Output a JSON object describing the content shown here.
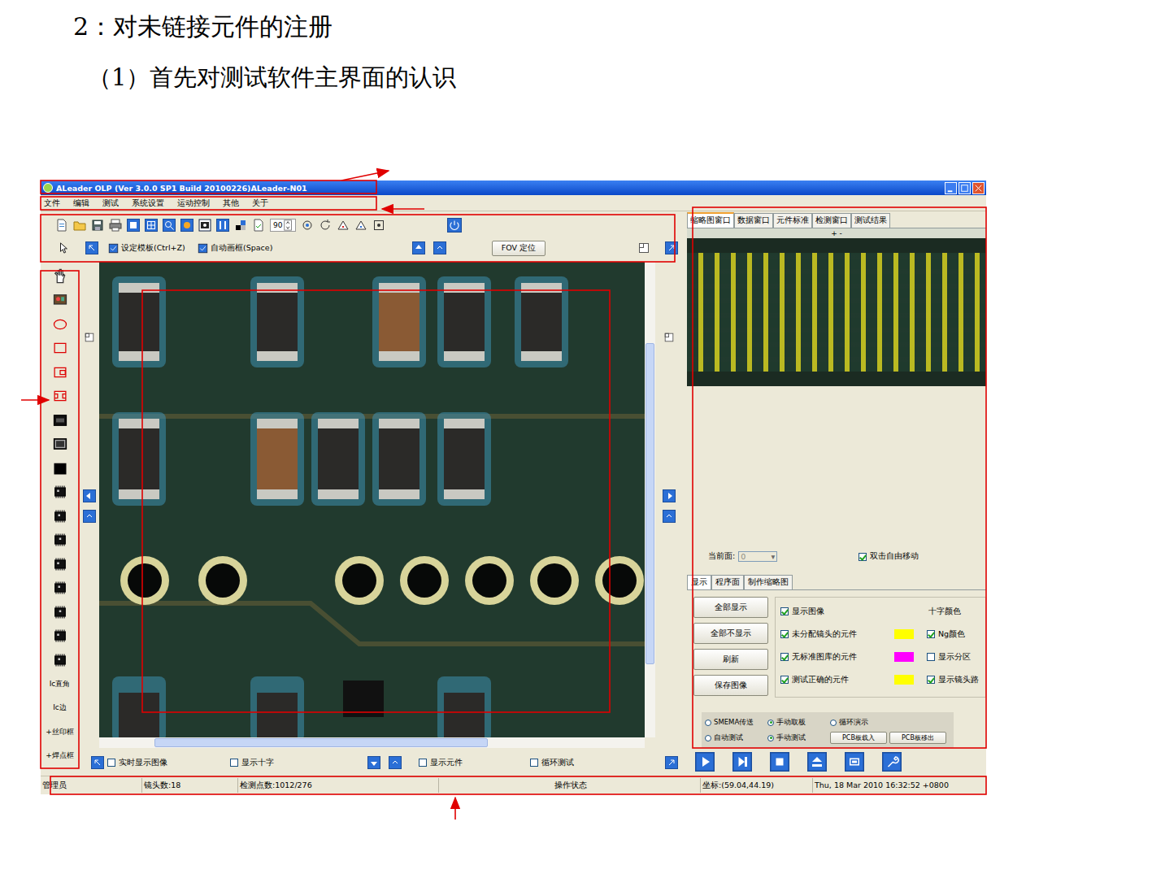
{
  "heading": "2：对未链接元件的注册",
  "subheading": "（1）首先对测试软件主界面的认识",
  "window": {
    "title": "ALeader OLP  (Ver 3.0.0 SP1 Build 20100226)ALeader-N01"
  },
  "menu": [
    "文件",
    "编辑",
    "测试",
    "系统设置",
    "运动控制",
    "其他",
    "关于"
  ],
  "toolbar": {
    "rotation": "90"
  },
  "template_bar": {
    "set_template": "设定模板(Ctrl+Z)",
    "auto_frame": "自动画框(Space)",
    "fov_button": "FOV 定位"
  },
  "tool_labels": [
    "Ic直角",
    "Ic边",
    "+丝印框",
    "+焊点框"
  ],
  "view_options": [
    {
      "label": "实时显示图像",
      "checked": false
    },
    {
      "label": "显示十字",
      "checked": false
    },
    {
      "label": "显示元件",
      "checked": false
    },
    {
      "label": "循环测试",
      "checked": false
    }
  ],
  "right_tabs": [
    {
      "label": "缩略图窗口",
      "selected": true
    },
    {
      "label": "数据窗口",
      "selected": false
    },
    {
      "label": "元件标准",
      "selected": false
    },
    {
      "label": "检测窗口",
      "selected": false
    },
    {
      "label": "测试结果",
      "selected": false
    }
  ],
  "thumbnail": {
    "zoom": "+ -"
  },
  "face": {
    "label": "当前面:",
    "value": "0",
    "disabled": true
  },
  "free_move": {
    "label": "双击自由移动",
    "checked": true
  },
  "display_tabs": [
    {
      "label": "显示",
      "selected": true
    },
    {
      "label": "程序面",
      "selected": false
    },
    {
      "label": "制作缩略图",
      "selected": false
    }
  ],
  "display_buttons": [
    "全部显示",
    "全部不显示",
    "刷新",
    "保存图像"
  ],
  "display_checks": [
    {
      "label": "显示图像",
      "checked": true
    },
    {
      "label": "未分配镜头的元件",
      "checked": true,
      "color": "#ffff00"
    },
    {
      "label": "无标准图库的元件",
      "checked": true,
      "color": "#ff00ff"
    },
    {
      "label": "测试正确的元件",
      "checked": true,
      "color": "#ffff00"
    }
  ],
  "display_options_right": [
    {
      "kind": "label",
      "label": "十字颜色"
    },
    {
      "kind": "checkbox",
      "label": "Ng颜色",
      "checked": true
    },
    {
      "kind": "checkbox",
      "label": "显示分区",
      "checked": false
    },
    {
      "kind": "checkbox",
      "label": "显示镜头路",
      "checked": true
    }
  ],
  "transfer_modes": [
    {
      "label": "SMEMA传送",
      "selected": false
    },
    {
      "label": "手动取板",
      "selected": true
    },
    {
      "label": "循环演示",
      "selected": false
    }
  ],
  "test_modes": [
    {
      "label": "自动测试",
      "selected": false
    },
    {
      "label": "手动测试",
      "selected": true
    }
  ],
  "pcb_buttons": [
    "PCB板载入",
    "PCB板移出"
  ],
  "status_bar": [
    "管理员",
    "镜头数:18",
    "检测点数:1012/276",
    "操作状态",
    "坐标:(59.04,44.19)",
    "Thu, 18 Mar 2010 16:32:52 +0800"
  ]
}
